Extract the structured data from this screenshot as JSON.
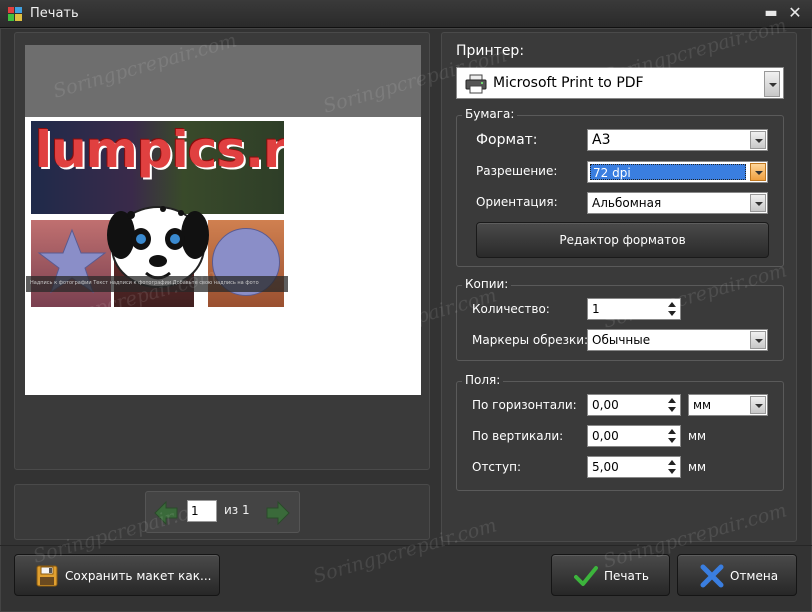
{
  "window": {
    "title": "Печать",
    "minimize_glyph": "▬",
    "close_glyph": "✕"
  },
  "preview": {
    "banner_text": "lumpics.ru",
    "caption_text": "Надпись к фотографии    Текст надписи к фотографии    Добавьте свою надпись на фото",
    "page_current": "1",
    "page_of_label": "из 1"
  },
  "printer": {
    "label": "Принтер:",
    "selected": "Microsoft Print to PDF"
  },
  "paper": {
    "group_label": "Бумага:",
    "format_label": "Формат:",
    "format_value": "A3",
    "resolution_label": "Разрешение:",
    "resolution_value": "72 dpi",
    "orientation_label": "Ориентация:",
    "orientation_value": "Альбомная",
    "editor_button": "Редактор форматов"
  },
  "copies": {
    "group_label": "Копии:",
    "count_label": "Количество:",
    "count_value": "1",
    "crop_marks_label": "Маркеры обрезки:",
    "crop_marks_value": "Обычные"
  },
  "margins": {
    "group_label": "Поля:",
    "horizontal_label": "По горизонтали:",
    "horizontal_value": "0,00",
    "unit_select": "мм",
    "vertical_label": "По вертикали:",
    "vertical_value": "0,00",
    "vertical_unit": "мм",
    "indent_label": "Отступ:",
    "indent_value": "5,00",
    "indent_unit": "мм"
  },
  "footer": {
    "save_layout": "Сохранить макет как...",
    "print": "Печать",
    "cancel": "Отмена"
  },
  "watermark_text": "Soringpcrepair.com",
  "colors": {
    "accent_green": "#3cb43c",
    "cancel_blue": "#3a7ee0",
    "selection_blue": "#3a7ee0",
    "panel_bg": "#3a3a3a"
  }
}
